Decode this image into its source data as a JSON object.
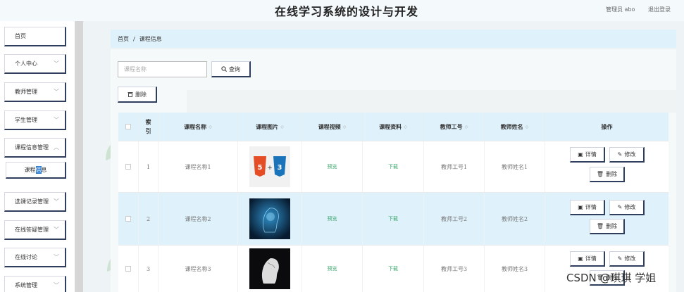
{
  "header": {
    "title": "在线学习系统的设计与开发",
    "user": "管理员 abo",
    "logout": "退出登录"
  },
  "sidebar": {
    "items": [
      {
        "label": "首页",
        "chevron": false
      },
      {
        "label": "个人中心",
        "chevron": true
      },
      {
        "label": "教师管理",
        "chevron": true
      },
      {
        "label": "学生管理",
        "chevron": true
      },
      {
        "label": "课程信息管理",
        "chevron": true
      },
      {
        "label": "选课记录管理",
        "chevron": true
      },
      {
        "label": "在线答疑管理",
        "chevron": true
      },
      {
        "label": "在线讨论",
        "chevron": true
      },
      {
        "label": "系统管理",
        "chevron": true
      }
    ],
    "sub_item": {
      "label_a": "课程",
      "label_b": "信",
      "label_c": "息"
    }
  },
  "breadcrumb": {
    "home": "首页",
    "separator": "/",
    "current": "课程信息"
  },
  "search": {
    "placeholder": "课程名称",
    "button_label": "查询",
    "search_icon": "search-icon"
  },
  "toolbar": {
    "delete_label": "删除",
    "delete_icon": "trash-icon"
  },
  "table": {
    "columns": [
      {
        "key": "checkbox",
        "label": ""
      },
      {
        "key": "index",
        "label_a": "索",
        "label_b": "引"
      },
      {
        "key": "course_name",
        "label": "课程名称",
        "sortable": true
      },
      {
        "key": "course_image",
        "label": "课程图片",
        "sortable": true
      },
      {
        "key": "course_video",
        "label": "课程视频",
        "sortable": true
      },
      {
        "key": "course_material",
        "label": "课程资料",
        "sortable": true
      },
      {
        "key": "teacher_id",
        "label": "教师工号",
        "sortable": true
      },
      {
        "key": "teacher_name",
        "label": "教师姓名",
        "sortable": true
      },
      {
        "key": "ops",
        "label": "操作"
      }
    ],
    "sort_icon": "◇",
    "rows": [
      {
        "index": "1",
        "course_name": "课程名称1",
        "image": "html5-css3",
        "video": "预览",
        "material": "下载",
        "teacher_id": "教师工号1",
        "teacher_name": "教师姓名1"
      },
      {
        "index": "2",
        "course_name": "课程名称2",
        "image": "ai-head-blue",
        "video": "预览",
        "material": "下载",
        "teacher_id": "教师工号2",
        "teacher_name": "教师姓名2"
      },
      {
        "index": "3",
        "course_name": "课程名称3",
        "image": "ai-head-dark",
        "video": "预览",
        "material": "下载",
        "teacher_id": "教师工号3",
        "teacher_name": "教师姓名3"
      }
    ],
    "ops": {
      "detail": "详情",
      "edit": "修改",
      "delete": "删除"
    }
  },
  "watermark": "CSDN @琪琪 学姐",
  "colors": {
    "accent": "#2f3e5c",
    "header_bg": "#dff1fb",
    "link_green": "#3aa86b",
    "highlight": "#2e7fd6"
  }
}
